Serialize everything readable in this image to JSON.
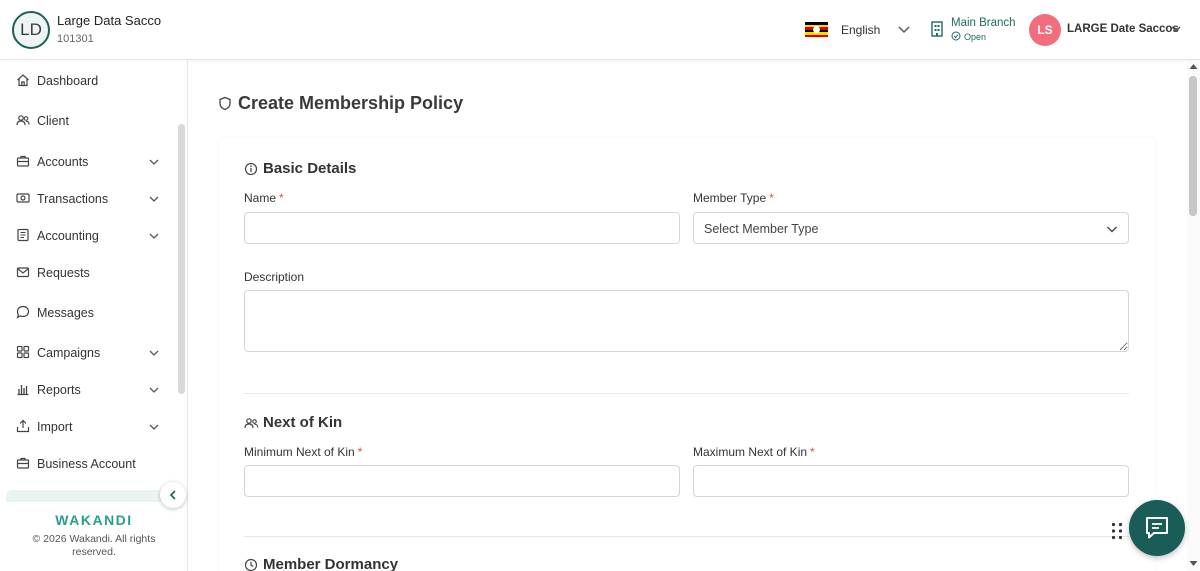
{
  "header": {
    "org_initials": "LD",
    "org_name": "Large Data Sacco",
    "org_id": "101301",
    "language": "English",
    "branch_name": "Main Branch",
    "branch_status": "Open",
    "user_initials": "LS",
    "user_name": "LARGE Date Saccos"
  },
  "colors": {
    "primary": "#1d5f5a",
    "accent": "#2a9d8f",
    "avatar": "#f26d7d",
    "required": "#e04a4a"
  },
  "sidebar": {
    "items": [
      {
        "label": "Dashboard",
        "icon": "home-icon",
        "expandable": false
      },
      {
        "label": "Client",
        "icon": "users-icon",
        "expandable": false
      },
      {
        "label": "Accounts",
        "icon": "briefcase-icon",
        "expandable": true
      },
      {
        "label": "Transactions",
        "icon": "cash-icon",
        "expandable": true
      },
      {
        "label": "Accounting",
        "icon": "ledger-icon",
        "expandable": true
      },
      {
        "label": "Requests",
        "icon": "mail-icon",
        "expandable": false
      },
      {
        "label": "Messages",
        "icon": "chat-bubble-icon",
        "expandable": false
      },
      {
        "label": "Campaigns",
        "icon": "grid-icon",
        "expandable": true
      },
      {
        "label": "Reports",
        "icon": "bar-chart-icon",
        "expandable": true
      },
      {
        "label": "Import",
        "icon": "upload-icon",
        "expandable": true
      },
      {
        "label": "Business Account",
        "icon": "briefcase-icon",
        "expandable": false
      }
    ],
    "brand": "WAKANDI",
    "copyright": "© 2026 Wakandi. All rights reserved."
  },
  "page": {
    "title": "Create Membership Policy"
  },
  "form": {
    "basic_details": {
      "title": "Basic Details",
      "name_label": "Name",
      "name_value": "",
      "member_type_label": "Member Type",
      "member_type_value": "Select Member Type",
      "description_label": "Description",
      "description_value": ""
    },
    "next_of_kin": {
      "title": "Next of Kin",
      "min_label": "Minimum Next of Kin",
      "min_value": "",
      "max_label": "Maximum Next of Kin",
      "max_value": ""
    },
    "member_dormancy": {
      "title": "Member Dormancy"
    },
    "required_marker": "*"
  }
}
